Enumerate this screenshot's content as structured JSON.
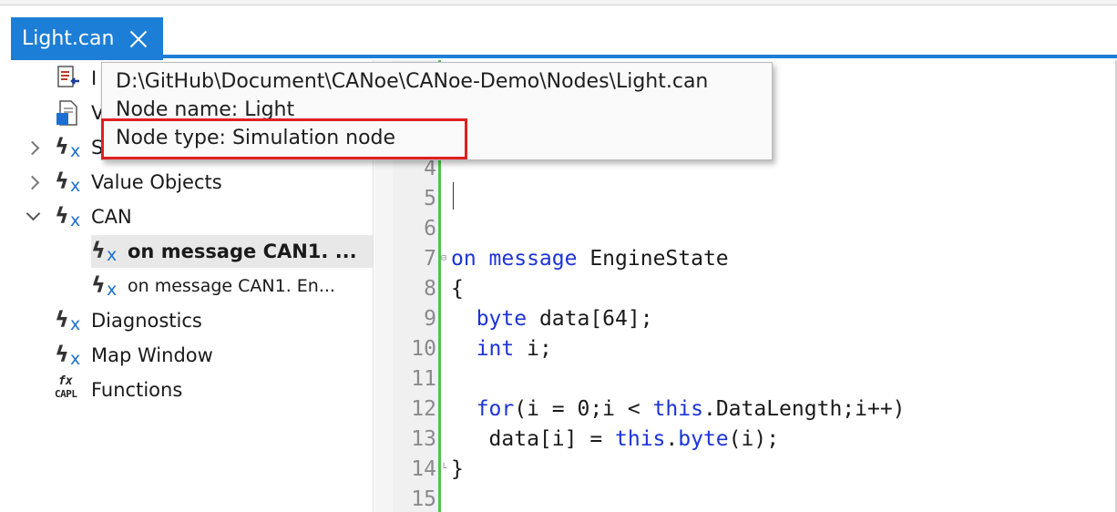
{
  "tab": {
    "title": "Light.can"
  },
  "tooltip": {
    "path": "D:\\GitHub\\Document\\CANoe\\CANoe-Demo\\Nodes\\Light.can",
    "node_name": "Node name: Light",
    "node_type": "Node type: Simulation node"
  },
  "tree": {
    "items": [
      {
        "label": "I",
        "icon": "include-icon",
        "expander": "none"
      },
      {
        "label": "V",
        "icon": "variables-icon",
        "expander": "none"
      },
      {
        "label": "S",
        "icon": "function-icon",
        "expander": "collapsed"
      },
      {
        "label": "Value Objects",
        "icon": "function-icon",
        "expander": "collapsed"
      },
      {
        "label": "CAN",
        "icon": "function-icon",
        "expander": "expanded"
      },
      {
        "label": "on message CAN1. ...",
        "icon": "function-icon",
        "expander": "none",
        "selected": true
      },
      {
        "label": "on message CAN1. En...",
        "icon": "function-icon",
        "expander": "none"
      },
      {
        "label": "Diagnostics",
        "icon": "function-icon",
        "expander": "none"
      },
      {
        "label": "Map Window",
        "icon": "function-icon",
        "expander": "none"
      },
      {
        "label": "Functions",
        "icon": "capl-functions-icon",
        "expander": "none"
      }
    ]
  },
  "editor": {
    "lines": [
      {
        "num": "4",
        "text": ""
      },
      {
        "num": "5",
        "text": ""
      },
      {
        "num": "6",
        "text": ""
      },
      {
        "num": "7",
        "kw1": "on message",
        "rest": " EngineState"
      },
      {
        "num": "8",
        "text": "{"
      },
      {
        "num": "9",
        "kw1": "  byte",
        "rest": " data[64];"
      },
      {
        "num": "10",
        "kw1": "  int",
        "rest": " i;"
      },
      {
        "num": "11",
        "text": ""
      },
      {
        "num": "12",
        "kw1": "  for",
        "rest": "(i = 0;i < ",
        "kw2": "this",
        "rest2": ".DataLength;i++)"
      },
      {
        "num": "13",
        "pre": "   data[i] = ",
        "kw1": "this",
        "rest": ".",
        "kw2": "byte",
        "rest2": "(i);"
      },
      {
        "num": "14",
        "text": "}"
      },
      {
        "num": "15",
        "text": ""
      }
    ]
  },
  "colors": {
    "accent": "#1c7ed6",
    "keyword": "#1c33d6",
    "highlight": "#e02020",
    "change_bar": "#4fc34f"
  }
}
